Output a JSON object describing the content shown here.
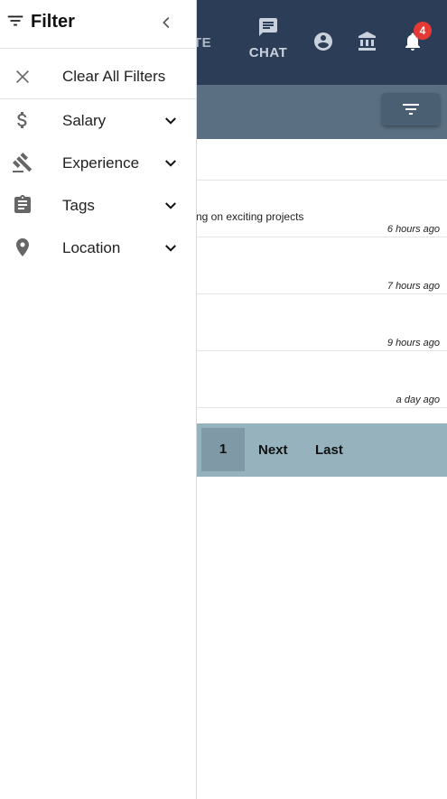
{
  "drawer": {
    "title": "Filter",
    "clear_label": "Clear All Filters",
    "items": [
      {
        "label": "Salary",
        "icon": "dollar-icon"
      },
      {
        "label": "Experience",
        "icon": "gavel-icon"
      },
      {
        "label": "Tags",
        "icon": "clipboard-icon"
      },
      {
        "label": "Location",
        "icon": "location-pin-icon"
      }
    ]
  },
  "nav": {
    "partial_label": "TE",
    "chat_label": "CHAT",
    "notification_count": "4"
  },
  "jobs": [
    {
      "desc": "ng on exciting projects",
      "time": "6 hours ago"
    },
    {
      "desc": "",
      "time": "7 hours ago"
    },
    {
      "desc": "",
      "time": "9 hours ago"
    },
    {
      "desc": "",
      "time": "a day ago"
    }
  ],
  "pagination": {
    "current": "1",
    "next_label": "Next",
    "last_label": "Last"
  },
  "colors": {
    "topbar": "#2c3e57",
    "filterbar": "#5b6f82",
    "pagination": "#95b2bd",
    "badge": "#e53935"
  }
}
